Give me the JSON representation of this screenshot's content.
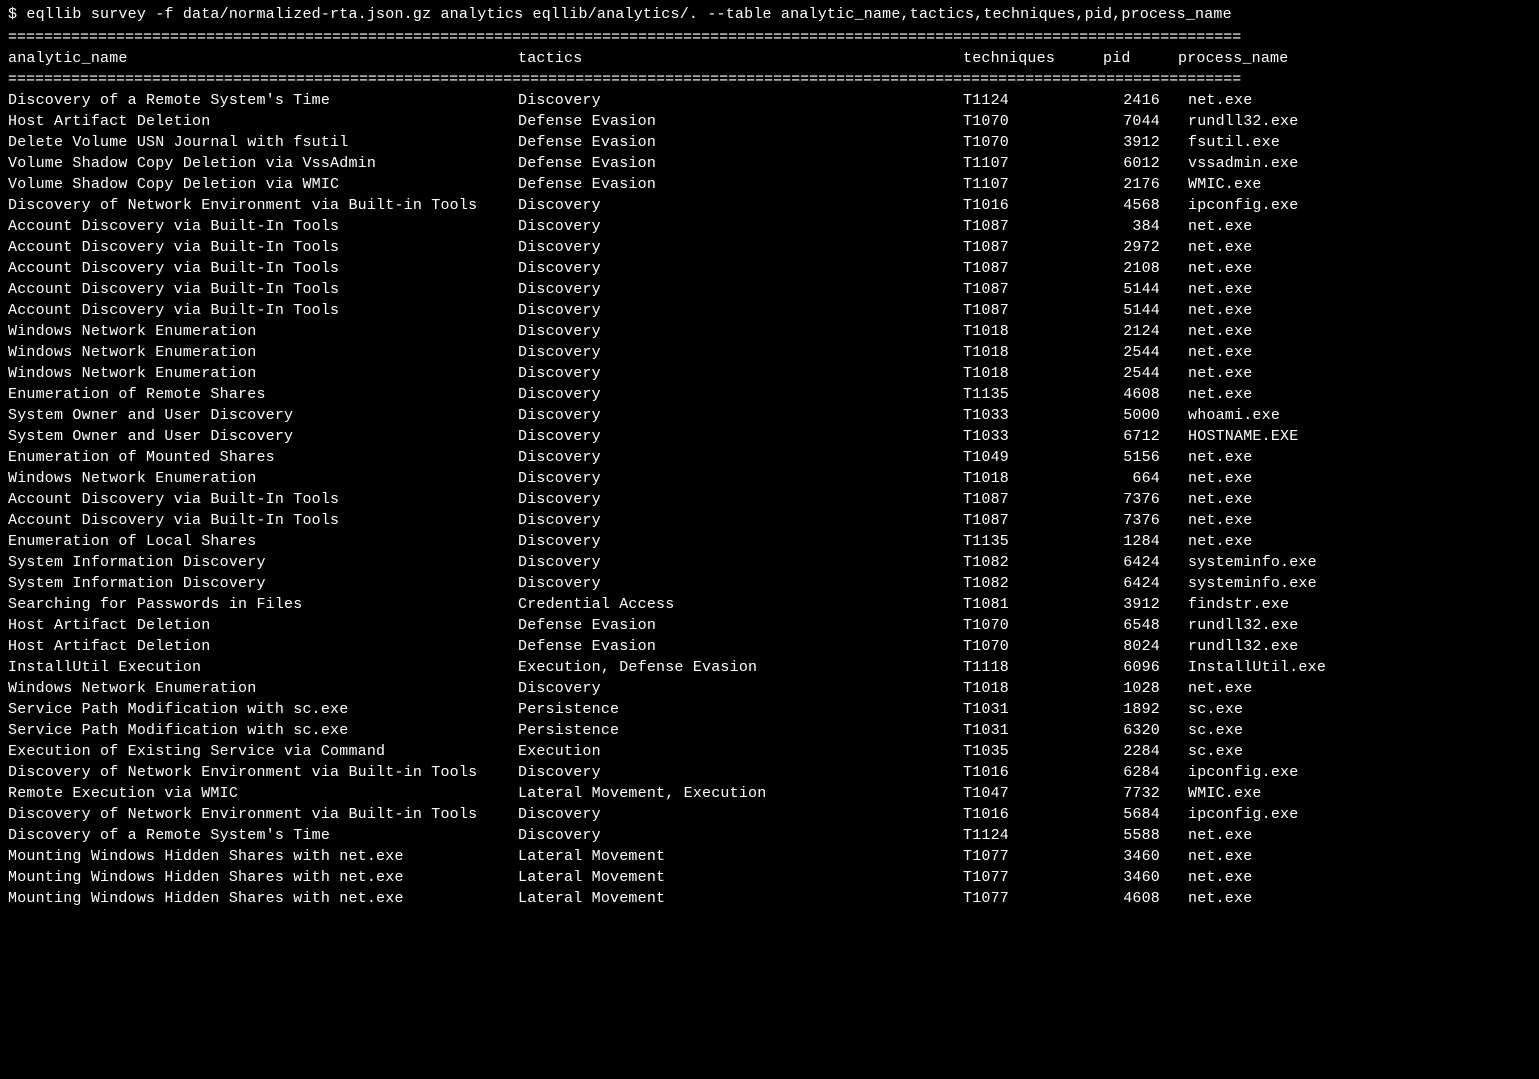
{
  "prompt": "$",
  "command": "eqllib survey -f data/normalized-rta.json.gz analytics eqllib/analytics/. --table analytic_name,tactics,techniques,pid,process_name",
  "rule": "=========================================================================================================================================",
  "headers": {
    "analytic_name": "analytic_name",
    "tactics": "tactics",
    "techniques": "techniques",
    "pid": "pid",
    "process_name": "process_name"
  },
  "rows": [
    {
      "analytic_name": "Discovery of a Remote System's Time",
      "tactics": "Discovery",
      "techniques": "T1124",
      "pid": "2416",
      "process_name": "net.exe"
    },
    {
      "analytic_name": "Host Artifact Deletion",
      "tactics": "Defense Evasion",
      "techniques": "T1070",
      "pid": "7044",
      "process_name": "rundll32.exe"
    },
    {
      "analytic_name": "Delete Volume USN Journal with fsutil",
      "tactics": "Defense Evasion",
      "techniques": "T1070",
      "pid": "3912",
      "process_name": "fsutil.exe"
    },
    {
      "analytic_name": "Volume Shadow Copy Deletion via VssAdmin",
      "tactics": "Defense Evasion",
      "techniques": "T1107",
      "pid": "6012",
      "process_name": "vssadmin.exe"
    },
    {
      "analytic_name": "Volume Shadow Copy Deletion via WMIC",
      "tactics": "Defense Evasion",
      "techniques": "T1107",
      "pid": "2176",
      "process_name": "WMIC.exe"
    },
    {
      "analytic_name": "Discovery of Network Environment via Built-in Tools",
      "tactics": "Discovery",
      "techniques": "T1016",
      "pid": "4568",
      "process_name": "ipconfig.exe"
    },
    {
      "analytic_name": "Account Discovery via Built-In Tools",
      "tactics": "Discovery",
      "techniques": "T1087",
      "pid": "384",
      "process_name": "net.exe"
    },
    {
      "analytic_name": "Account Discovery via Built-In Tools",
      "tactics": "Discovery",
      "techniques": "T1087",
      "pid": "2972",
      "process_name": "net.exe"
    },
    {
      "analytic_name": "Account Discovery via Built-In Tools",
      "tactics": "Discovery",
      "techniques": "T1087",
      "pid": "2108",
      "process_name": "net.exe"
    },
    {
      "analytic_name": "Account Discovery via Built-In Tools",
      "tactics": "Discovery",
      "techniques": "T1087",
      "pid": "5144",
      "process_name": "net.exe"
    },
    {
      "analytic_name": "Account Discovery via Built-In Tools",
      "tactics": "Discovery",
      "techniques": "T1087",
      "pid": "5144",
      "process_name": "net.exe"
    },
    {
      "analytic_name": "Windows Network Enumeration",
      "tactics": "Discovery",
      "techniques": "T1018",
      "pid": "2124",
      "process_name": "net.exe"
    },
    {
      "analytic_name": "Windows Network Enumeration",
      "tactics": "Discovery",
      "techniques": "T1018",
      "pid": "2544",
      "process_name": "net.exe"
    },
    {
      "analytic_name": "Windows Network Enumeration",
      "tactics": "Discovery",
      "techniques": "T1018",
      "pid": "2544",
      "process_name": "net.exe"
    },
    {
      "analytic_name": "Enumeration of Remote Shares",
      "tactics": "Discovery",
      "techniques": "T1135",
      "pid": "4608",
      "process_name": "net.exe"
    },
    {
      "analytic_name": "System Owner and User Discovery",
      "tactics": "Discovery",
      "techniques": "T1033",
      "pid": "5000",
      "process_name": "whoami.exe"
    },
    {
      "analytic_name": "System Owner and User Discovery",
      "tactics": "Discovery",
      "techniques": "T1033",
      "pid": "6712",
      "process_name": "HOSTNAME.EXE"
    },
    {
      "analytic_name": "Enumeration of Mounted Shares",
      "tactics": "Discovery",
      "techniques": "T1049",
      "pid": "5156",
      "process_name": "net.exe"
    },
    {
      "analytic_name": "Windows Network Enumeration",
      "tactics": "Discovery",
      "techniques": "T1018",
      "pid": "664",
      "process_name": "net.exe"
    },
    {
      "analytic_name": "Account Discovery via Built-In Tools",
      "tactics": "Discovery",
      "techniques": "T1087",
      "pid": "7376",
      "process_name": "net.exe"
    },
    {
      "analytic_name": "Account Discovery via Built-In Tools",
      "tactics": "Discovery",
      "techniques": "T1087",
      "pid": "7376",
      "process_name": "net.exe"
    },
    {
      "analytic_name": "Enumeration of Local Shares",
      "tactics": "Discovery",
      "techniques": "T1135",
      "pid": "1284",
      "process_name": "net.exe"
    },
    {
      "analytic_name": "System Information Discovery",
      "tactics": "Discovery",
      "techniques": "T1082",
      "pid": "6424",
      "process_name": "systeminfo.exe"
    },
    {
      "analytic_name": "System Information Discovery",
      "tactics": "Discovery",
      "techniques": "T1082",
      "pid": "6424",
      "process_name": "systeminfo.exe"
    },
    {
      "analytic_name": "Searching for Passwords in Files",
      "tactics": "Credential Access",
      "techniques": "T1081",
      "pid": "3912",
      "process_name": "findstr.exe"
    },
    {
      "analytic_name": "Host Artifact Deletion",
      "tactics": "Defense Evasion",
      "techniques": "T1070",
      "pid": "6548",
      "process_name": "rundll32.exe"
    },
    {
      "analytic_name": "Host Artifact Deletion",
      "tactics": "Defense Evasion",
      "techniques": "T1070",
      "pid": "8024",
      "process_name": "rundll32.exe"
    },
    {
      "analytic_name": "InstallUtil Execution",
      "tactics": "Execution, Defense Evasion",
      "techniques": "T1118",
      "pid": "6096",
      "process_name": "InstallUtil.exe"
    },
    {
      "analytic_name": "Windows Network Enumeration",
      "tactics": "Discovery",
      "techniques": "T1018",
      "pid": "1028",
      "process_name": "net.exe"
    },
    {
      "analytic_name": "Service Path Modification with sc.exe",
      "tactics": "Persistence",
      "techniques": "T1031",
      "pid": "1892",
      "process_name": "sc.exe"
    },
    {
      "analytic_name": "Service Path Modification with sc.exe",
      "tactics": "Persistence",
      "techniques": "T1031",
      "pid": "6320",
      "process_name": "sc.exe"
    },
    {
      "analytic_name": "Execution of Existing Service via Command",
      "tactics": "Execution",
      "techniques": "T1035",
      "pid": "2284",
      "process_name": "sc.exe"
    },
    {
      "analytic_name": "Discovery of Network Environment via Built-in Tools",
      "tactics": "Discovery",
      "techniques": "T1016",
      "pid": "6284",
      "process_name": "ipconfig.exe"
    },
    {
      "analytic_name": "Remote Execution via WMIC",
      "tactics": "Lateral Movement, Execution",
      "techniques": "T1047",
      "pid": "7732",
      "process_name": "WMIC.exe"
    },
    {
      "analytic_name": "Discovery of Network Environment via Built-in Tools",
      "tactics": "Discovery",
      "techniques": "T1016",
      "pid": "5684",
      "process_name": "ipconfig.exe"
    },
    {
      "analytic_name": "Discovery of a Remote System's Time",
      "tactics": "Discovery",
      "techniques": "T1124",
      "pid": "5588",
      "process_name": "net.exe"
    },
    {
      "analytic_name": "Mounting Windows Hidden Shares with net.exe",
      "tactics": "Lateral Movement",
      "techniques": "T1077",
      "pid": "3460",
      "process_name": "net.exe"
    },
    {
      "analytic_name": "Mounting Windows Hidden Shares with net.exe",
      "tactics": "Lateral Movement",
      "techniques": "T1077",
      "pid": "3460",
      "process_name": "net.exe"
    },
    {
      "analytic_name": "Mounting Windows Hidden Shares with net.exe",
      "tactics": "Lateral Movement",
      "techniques": "T1077",
      "pid": "4608",
      "process_name": "net.exe"
    }
  ]
}
